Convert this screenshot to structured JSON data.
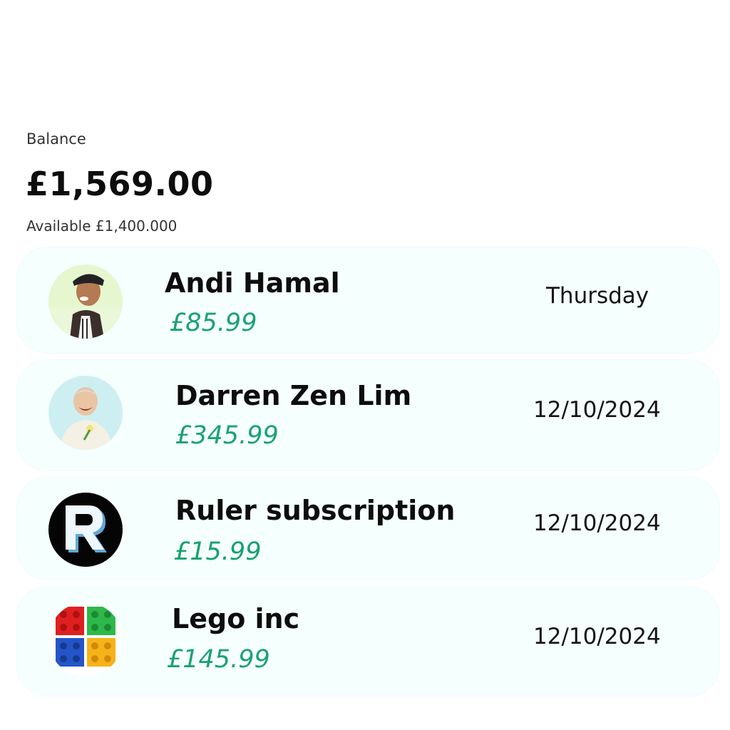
{
  "balance": {
    "label": "Balance",
    "amount": "£1,569.00",
    "available": "Available £1,400.000"
  },
  "colors": {
    "amount_green": "#1aa174",
    "card_background": "#f5fffd"
  },
  "transactions": [
    {
      "name": "Andi Hamal",
      "amount": "£85.99",
      "date": "Thursday",
      "avatar_icon": "person-chef-photo-icon"
    },
    {
      "name": "Darren Zen Lim",
      "amount": "£345.99",
      "date": "12/10/2024",
      "avatar_icon": "person-flowers-photo-icon"
    },
    {
      "name": "Ruler subscription",
      "amount": "£15.99",
      "date": "12/10/2024",
      "avatar_icon": "letter-r-logo-icon"
    },
    {
      "name": "Lego inc",
      "amount": "£145.99",
      "date": "12/10/2024",
      "avatar_icon": "lego-bricks-logo-icon"
    }
  ]
}
